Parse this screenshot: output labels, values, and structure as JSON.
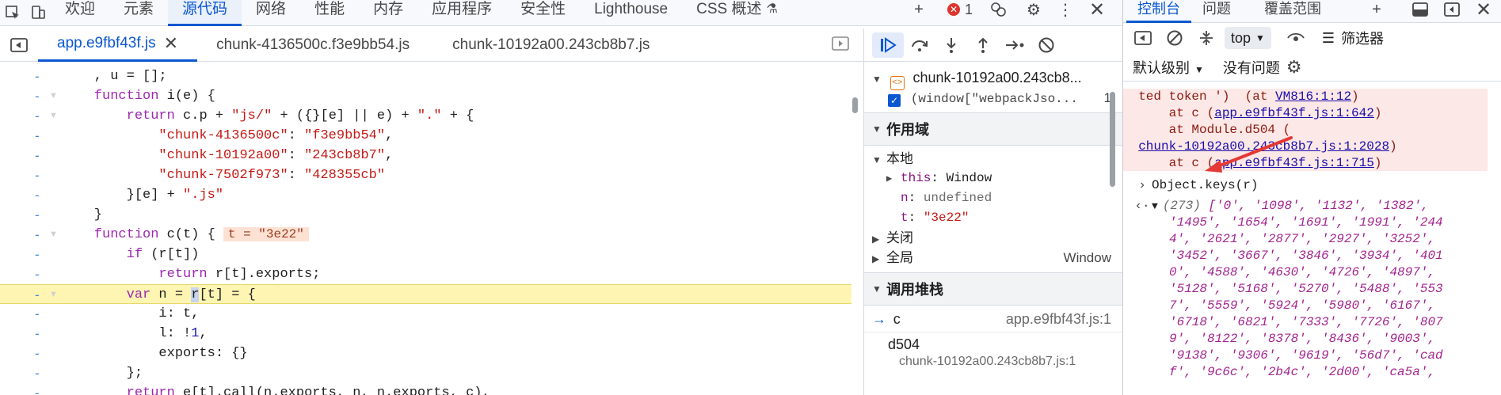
{
  "main_tabs": [
    "欢迎",
    "元素",
    "源代码",
    "网络",
    "性能",
    "内存",
    "应用程序",
    "安全性",
    "Lighthouse",
    "CSS 概述"
  ],
  "main_tabs_active": "源代码",
  "error_badge": "1",
  "file_tabs": [
    "app.e9fbf43f.js",
    "chunk-4136500c.f3e9bb54.js",
    "chunk-10192a00.243cb8b7.js"
  ],
  "code_lines": [
    {
      "gutter": "-",
      "text": "    , u = [];"
    },
    {
      "gutter": "-",
      "text": "function i(e) {"
    },
    {
      "gutter": "-",
      "text": "    return c.p + \"js/\" + ({}[e] || e) + \".\" + {"
    },
    {
      "gutter": "-",
      "text": "        \"chunk-4136500c\": \"f3e9bb54\","
    },
    {
      "gutter": "-",
      "text": "        \"chunk-10192a00\": \"243cb8b7\","
    },
    {
      "gutter": "-",
      "text": "        \"chunk-7502f973\": \"428355cb\""
    },
    {
      "gutter": "-",
      "text": "    }[e] + \".js\""
    },
    {
      "gutter": "-",
      "text": "}"
    },
    {
      "gutter": "-",
      "text": "function c(t) {"
    },
    {
      "gutter": "-",
      "text": "    if (r[t])"
    },
    {
      "gutter": "-",
      "text": "        return r[t].exports;"
    },
    {
      "gutter": "-",
      "text": "    var n = r[t] = {"
    },
    {
      "gutter": "-",
      "text": "        i: t,"
    },
    {
      "gutter": "-",
      "text": "        l: !1,"
    },
    {
      "gutter": "-",
      "text": "        exports: {}"
    },
    {
      "gutter": "-",
      "text": "    };"
    },
    {
      "gutter": "-",
      "text": "    return e[t].call(n.exports, n, n.exports, c),"
    }
  ],
  "inline_value": "t = \"3e22\"",
  "debugger": {
    "breakpoint_file": "chunk-10192a00.243cb8...",
    "breakpoint_code": "(window[\"webpackJso...",
    "breakpoint_line": "1",
    "scope_title": "作用域",
    "local_title": "本地",
    "scope_vars": [
      {
        "key": "this",
        "value": "Window"
      },
      {
        "key": "n",
        "value": "undefined"
      },
      {
        "key": "t",
        "value": "\"3e22\""
      }
    ],
    "closure_title": "关闭",
    "global_title": "全局",
    "global_value": "Window",
    "callstack_title": "调用堆栈",
    "frames": [
      {
        "name": "c",
        "loc": "app.e9fbf43f.js:1"
      },
      {
        "name": "d504",
        "loc": "chunk-10192a00.243cb8b7.js:1"
      }
    ]
  },
  "console": {
    "tabs": [
      "控制台",
      "问题",
      "覆盖范围"
    ],
    "context": "top",
    "filter_label": "筛选器",
    "level_label": "默认级别",
    "issues_label": "没有问题",
    "error_lines": [
      {
        "pre": "  ted token ')  (at ",
        "link": "VM816:1:12",
        "post": ")"
      },
      {
        "pre": "      at c (",
        "link": "app.e9fbf43f.js:1:642",
        "post": ")"
      },
      {
        "pre": "      at Module.d504 (",
        "link": "",
        "post": ""
      },
      {
        "pre": "  ",
        "link": "chunk-10192a00.243cb8b7.js:1:2028",
        "post": ")"
      },
      {
        "pre": "      at c (",
        "link": "app.e9fbf43f.js:1:715",
        "post": ")"
      }
    ],
    "input_expr": "Object.keys(r)",
    "result_count": "(273)",
    "result_lines": [
      "['0', '1098', '1132', '1382',",
      "'1495', '1654', '1691', '1991', '244",
      "4', '2621', '2877', '2927', '3252',",
      "'3452', '3667', '3846', '3934', '401",
      "0', '4588', '4630', '4726', '4897',",
      "'5128', '5168', '5270', '5488', '553",
      "7', '5559', '5924', '5980', '6167',",
      "'6718', '6821', '7333', '7726', '807",
      "9', '8122', '8378', '8436', '9003',",
      "'9138', '9306', '9619', '56d7', 'cad",
      "f', '9c6c', '2b4c', '2d00', 'ca5a',"
    ]
  }
}
